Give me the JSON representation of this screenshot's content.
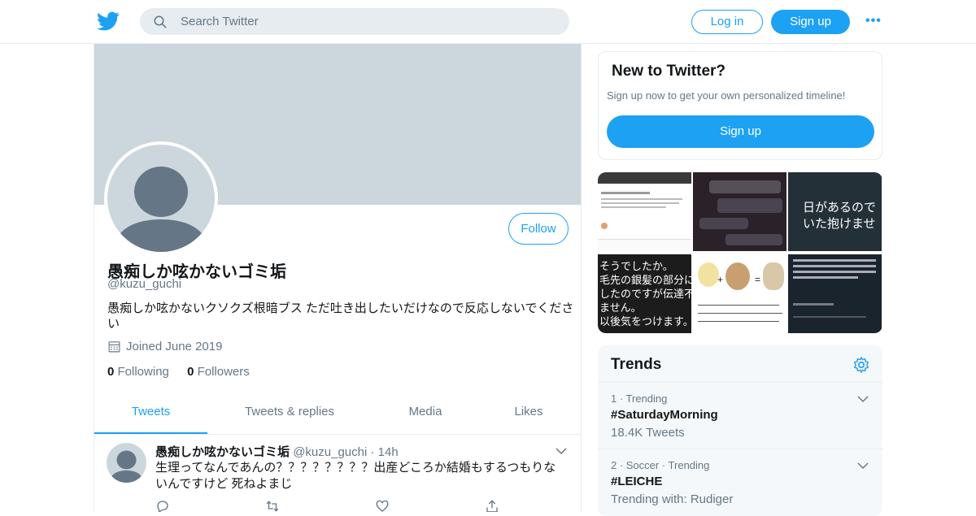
{
  "header": {
    "search_placeholder": "Search Twitter",
    "login_label": "Log in",
    "signup_label": "Sign up",
    "more_label": "•••"
  },
  "colors": {
    "accent": "#1da1f2",
    "muted": "#657786",
    "banner": "#ccd6dd",
    "border": "#e6ecf0"
  },
  "profile": {
    "name": "愚痴しか呟かないゴミ垢",
    "handle": "@kuzu_guchi",
    "bio": "愚痴しか呟かないクソクズ根暗ブス ただ吐き出したいだけなので反応しないでください",
    "joined": "Joined June 2019",
    "following_count": "0",
    "following_label": "Following",
    "followers_count": "0",
    "followers_label": "Followers",
    "follow_button": "Follow"
  },
  "tabs": [
    {
      "label": "Tweets",
      "active": true
    },
    {
      "label": "Tweets & replies",
      "active": false
    },
    {
      "label": "Media",
      "active": false
    },
    {
      "label": "Likes",
      "active": false
    }
  ],
  "tweet": {
    "name": "愚痴しか呟かないゴミ垢",
    "handle": "@kuzu_guchi",
    "sep": "·",
    "time": "14h",
    "text": "生理ってなんであんの？？？？？？？？出産どころか結婚もするつもりないんですけど 死ねよまじ"
  },
  "sidebar": {
    "new_title": "New to Twitter?",
    "new_subtitle": "Sign up now to get your own personalized timeline!",
    "new_button": "Sign up",
    "media_tiles": [
      {
        "icon": "instagram-screenshot",
        "text": ""
      },
      {
        "icon": "dark-chat-screenshot",
        "text": ""
      },
      {
        "icon": "dark-text-image",
        "text": "日があるので\nいた抱けませ"
      },
      {
        "icon": "dark-text-image",
        "text": "そうでしたか。\n毛先の銀髪の部分に\nしたのですが伝達不\nません。\n以後気をつけます。"
      },
      {
        "icon": "hair-diagram",
        "text": ""
      },
      {
        "icon": "dark-tweet-screenshot",
        "text": ""
      }
    ],
    "trends_title": "Trends",
    "trends": [
      {
        "meta": "1 · Trending",
        "name": "#SaturdayMorning",
        "count": "18.4K Tweets"
      },
      {
        "meta": "2 · Soccer · Trending",
        "name": "#LEICHE",
        "count": "Trending with: Rudiger"
      }
    ]
  }
}
